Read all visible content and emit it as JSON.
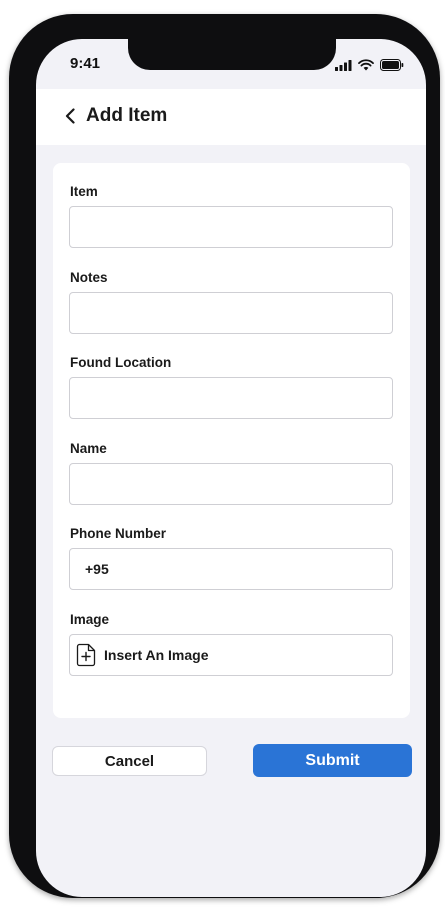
{
  "status_bar": {
    "time": "9:41"
  },
  "header": {
    "title": "Add Item"
  },
  "form": {
    "item": {
      "label": "Item",
      "value": ""
    },
    "notes": {
      "label": "Notes",
      "value": ""
    },
    "found_location": {
      "label": "Found Location",
      "value": ""
    },
    "name": {
      "label": "Name",
      "value": ""
    },
    "phone_number": {
      "label": "Phone Number",
      "value": "+95"
    },
    "image": {
      "label": "Image",
      "insert_label": "Insert An Image"
    }
  },
  "actions": {
    "cancel_label": "Cancel",
    "submit_label": "Submit"
  },
  "colors": {
    "accent": "#2a74d6",
    "background": "#f2f2f7"
  }
}
